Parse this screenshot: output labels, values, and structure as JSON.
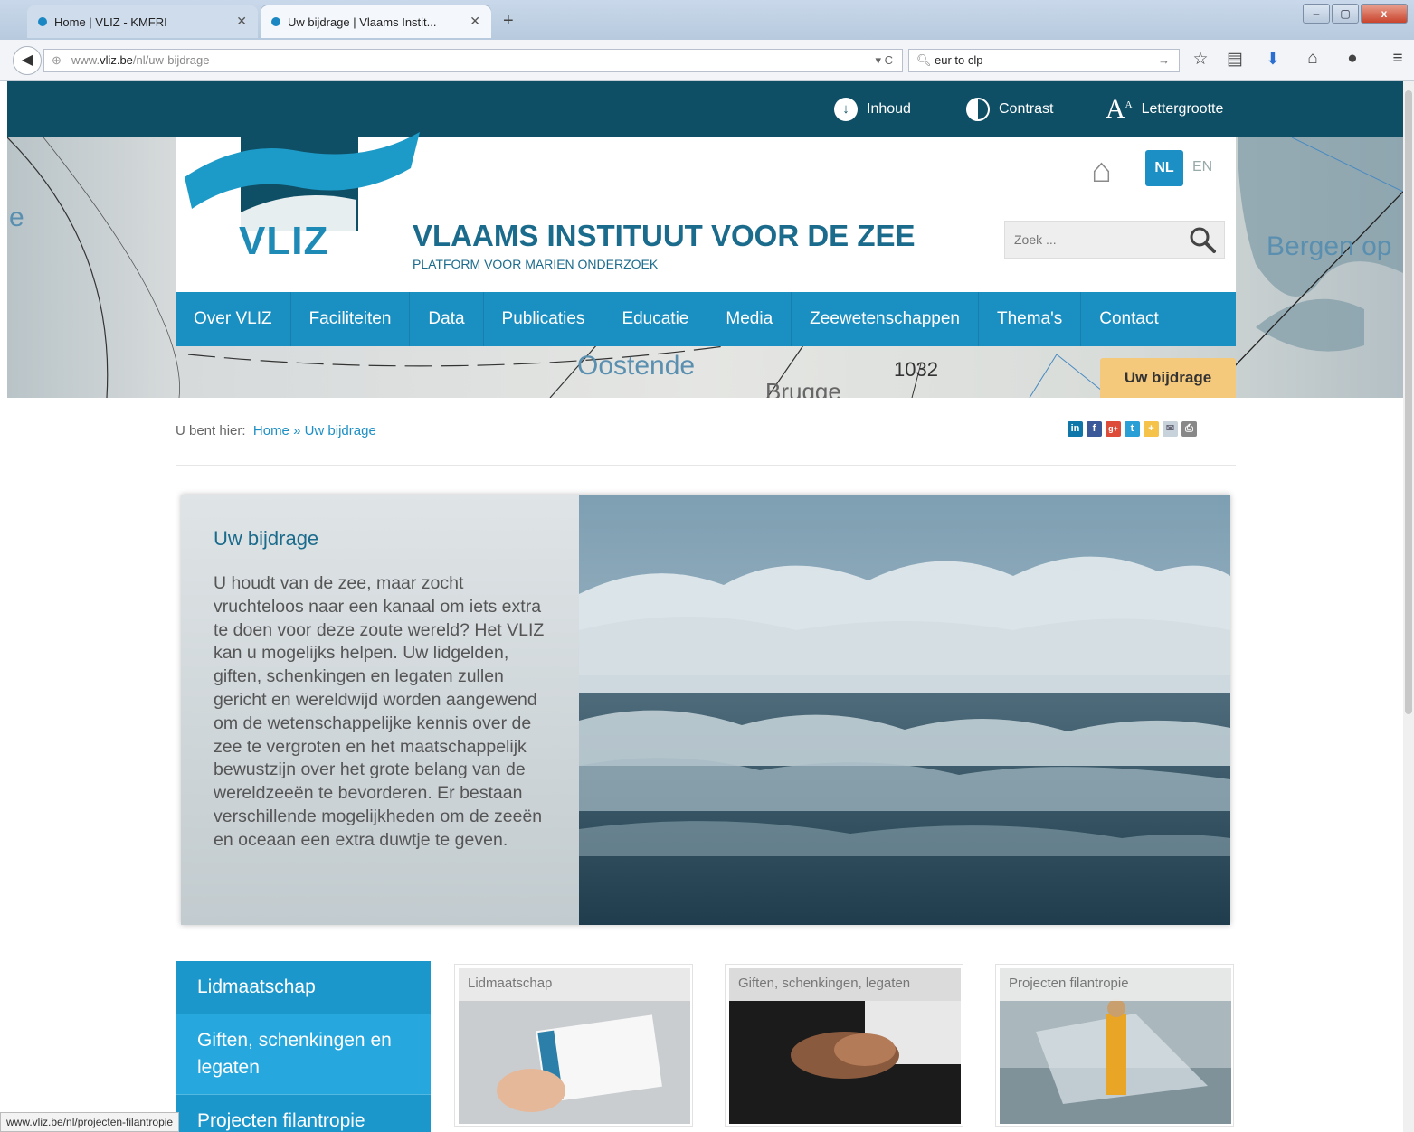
{
  "browser": {
    "tabs": [
      {
        "title": "Home | VLIZ - KMFRI",
        "active": false
      },
      {
        "title": "Uw bijdrage | Vlaams Instit...",
        "active": true
      }
    ],
    "new_tab": "+",
    "window_buttons": {
      "minimize": "–",
      "maximize": "▢",
      "close": "x"
    },
    "url": {
      "prefix": "www.",
      "domain": "vliz.be",
      "path": "/nl/uw-bijdrage"
    },
    "search_text": "eur to clp",
    "status_text": "www.vliz.be/nl/projecten-filantropie"
  },
  "topbar": {
    "inhoud": "Inhoud",
    "contrast": "Contrast",
    "lettergrootte": "Lettergrootte"
  },
  "header": {
    "logo_text": "VLIZ",
    "title": "VLAAMS INSTITUUT VOOR DE ZEE",
    "subtitle": "PLATFORM VOOR MARIEN ONDERZOEK",
    "lang_nl": "NL",
    "lang_en": "EN",
    "search_placeholder": "Zoek ..."
  },
  "map_labels": {
    "oostende": "Oostende",
    "brugge": "Brugge",
    "route": "1032",
    "bergen": "Bergen op",
    "left": "e"
  },
  "nav": [
    "Over VLIZ",
    "Faciliteiten",
    "Data",
    "Publicaties",
    "Educatie",
    "Media",
    "Zeewetenschappen",
    "Thema's",
    "Contact"
  ],
  "bijdrage_tab": "Uw bijdrage",
  "breadcrumb": {
    "prefix": "U bent hier:",
    "home": "Home",
    "sep": "»",
    "current": "Uw bijdrage"
  },
  "share": [
    "in",
    "f",
    "g+",
    "t",
    "+",
    "✉",
    "⎙"
  ],
  "hero": {
    "title": "Uw bijdrage",
    "body": "U houdt van de zee, maar zocht vruchteloos naar een kanaal om iets extra te doen voor deze zoute wereld? Het VLIZ kan u mogelijks helpen. Uw lidgelden, giften, schenkingen en legaten zullen gericht en wereldwijd worden aangewend om de wetenschappelijke kennis over de zee te vergroten en het maatschappelijk bewustzijn over het grote belang van de wereldzeeën te bevorderen. Er bestaan verschillende mogelijkheden om de zeeën en oceaan een extra duwtje te geven."
  },
  "side_menu": [
    "Lidmaatschap",
    "Giften, schenkingen en legaten",
    "Projecten filantropie"
  ],
  "cards": [
    {
      "title": "Lidmaatschap"
    },
    {
      "title": "Giften, schenkingen, legaten"
    },
    {
      "title": "Projecten filantropie"
    }
  ],
  "colors": {
    "topbar": "#0f4f66",
    "nav": "#1a8fc2",
    "accent": "#f5c97b",
    "title": "#1b6b8c"
  }
}
